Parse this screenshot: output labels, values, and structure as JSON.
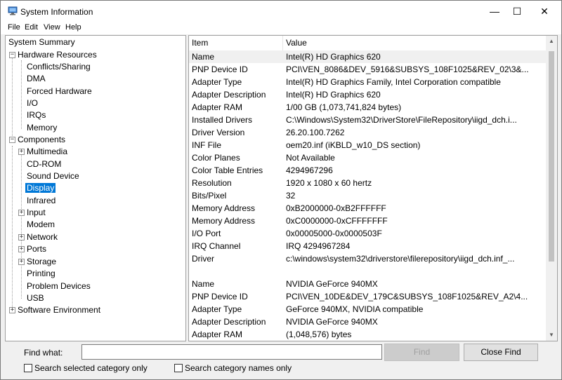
{
  "window": {
    "title": "System Information",
    "min_glyph": "—",
    "max_glyph": "☐",
    "close_glyph": "✕"
  },
  "menu": [
    "File",
    "Edit",
    "View",
    "Help"
  ],
  "tree": [
    {
      "label": "System Summary",
      "expander": ""
    },
    {
      "label": "Hardware Resources",
      "expander": "−"
    },
    {
      "label": "Conflicts/Sharing",
      "expander": ""
    },
    {
      "label": "DMA",
      "expander": ""
    },
    {
      "label": "Forced Hardware",
      "expander": ""
    },
    {
      "label": "I/O",
      "expander": ""
    },
    {
      "label": "IRQs",
      "expander": ""
    },
    {
      "label": "Memory",
      "expander": ""
    },
    {
      "label": "Components",
      "expander": "−"
    },
    {
      "label": "Multimedia",
      "expander": "+"
    },
    {
      "label": "CD-ROM",
      "expander": ""
    },
    {
      "label": "Sound Device",
      "expander": ""
    },
    {
      "label": "Display",
      "expander": "",
      "selected": true
    },
    {
      "label": "Infrared",
      "expander": ""
    },
    {
      "label": "Input",
      "expander": "+"
    },
    {
      "label": "Modem",
      "expander": ""
    },
    {
      "label": "Network",
      "expander": "+"
    },
    {
      "label": "Ports",
      "expander": "+"
    },
    {
      "label": "Storage",
      "expander": "+"
    },
    {
      "label": "Printing",
      "expander": ""
    },
    {
      "label": "Problem Devices",
      "expander": ""
    },
    {
      "label": "USB",
      "expander": ""
    },
    {
      "label": "Software Environment",
      "expander": "+"
    }
  ],
  "details": {
    "columns": {
      "item": "Item",
      "value": "Value"
    },
    "rows": [
      {
        "item": "Name",
        "value": "Intel(R) HD Graphics 620"
      },
      {
        "item": "PNP Device ID",
        "value": "PCI\\VEN_8086&DEV_5916&SUBSYS_108F1025&REV_02\\3&..."
      },
      {
        "item": "Adapter Type",
        "value": "Intel(R) HD Graphics Family, Intel Corporation compatible"
      },
      {
        "item": "Adapter Description",
        "value": "Intel(R) HD Graphics 620"
      },
      {
        "item": "Adapter RAM",
        "value": "1/00 GB (1,073,741,824 bytes)"
      },
      {
        "item": "Installed Drivers",
        "value": "C:\\Windows\\System32\\DriverStore\\FileRepository\\iigd_dch.i..."
      },
      {
        "item": "Driver Version",
        "value": "26.20.100.7262"
      },
      {
        "item": "INF File",
        "value": "oem20.inf (iKBLD_w10_DS section)"
      },
      {
        "item": "Color Planes",
        "value": "Not Available"
      },
      {
        "item": "Color Table Entries",
        "value": "4294967296"
      },
      {
        "item": "Resolution",
        "value": "1920 x 1080 x 60 hertz"
      },
      {
        "item": "Bits/Pixel",
        "value": "32"
      },
      {
        "item": "Memory Address",
        "value": "0xB2000000-0xB2FFFFFF"
      },
      {
        "item": "Memory Address",
        "value": "0xC0000000-0xCFFFFFFF"
      },
      {
        "item": "I/O Port",
        "value": "0x00005000-0x0000503F"
      },
      {
        "item": "IRQ Channel",
        "value": "IRQ 4294967284"
      },
      {
        "item": "Driver",
        "value": "c:\\windows\\system32\\driverstore\\filerepository\\iigd_dch.inf_..."
      },
      {
        "item": "",
        "value": ""
      },
      {
        "item": "Name",
        "value": "NVIDIA GeForce 940MX"
      },
      {
        "item": "PNP Device ID",
        "value": "PCI\\VEN_10DE&DEV_179C&SUBSYS_108F1025&REV_A2\\4..."
      },
      {
        "item": "Adapter Type",
        "value": "GeForce 940MX, NVIDIA compatible"
      },
      {
        "item": "Adapter Description",
        "value": "NVIDIA GeForce 940MX"
      },
      {
        "item": "Adapter RAM",
        "value": "(1,048,576) bytes"
      }
    ]
  },
  "find": {
    "label": "Find what:",
    "value": "",
    "find_button": "Find",
    "close_find_button": "Close Find",
    "search_selected": "Search selected category only",
    "search_names": "Search category names only"
  }
}
